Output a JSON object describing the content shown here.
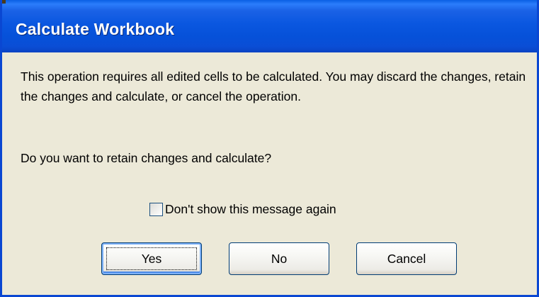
{
  "dialog": {
    "title": "Calculate Workbook",
    "message": "This operation requires all edited cells to be calculated.  You may discard the changes, retain the changes and calculate, or cancel the operation.",
    "question": "Do you want to retain changes and calculate?",
    "checkbox": {
      "label": "Don't show this message again",
      "checked": false
    },
    "buttons": {
      "yes": "Yes",
      "no": "No",
      "cancel": "Cancel"
    },
    "colors": {
      "title_bar": "#0a57e0",
      "frame": "#0a47d2",
      "body_background": "#ece9d8",
      "title_text": "#ffffff",
      "button_border": "#003c74"
    }
  }
}
